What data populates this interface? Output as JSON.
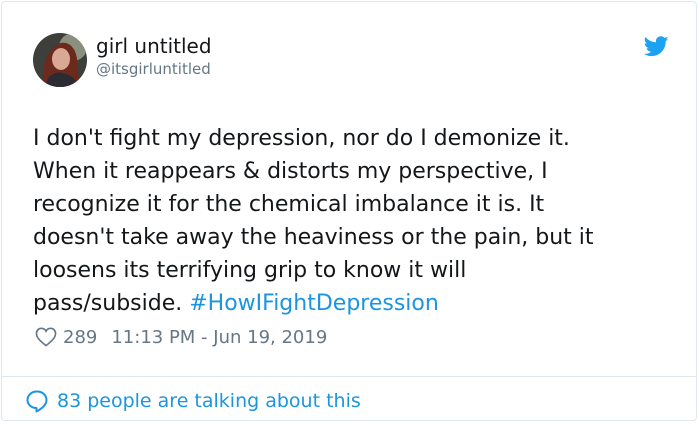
{
  "user": {
    "display_name": "girl untitled",
    "handle": "@itsgirluntitled"
  },
  "tweet": {
    "lines": [
      "I don't fight my depression, nor do I demonize it.",
      "When it reappears & distorts my perspective, I",
      "recognize it for the chemical imbalance it is. It",
      "doesn't take away the heaviness or the pain, but it",
      "loosens its terrifying grip to know it will"
    ],
    "last_line_text": "pass/subside. ",
    "hashtag": "#HowIFightDepression"
  },
  "meta": {
    "likes": "289",
    "timestamp": "11:13 PM - Jun 19, 2019"
  },
  "footer": {
    "talking": "83 people are talking about this"
  },
  "icons": {
    "bird": "twitter-bird-icon",
    "heart": "heart-outline-icon",
    "bubble": "speech-bubble-icon"
  },
  "colors": {
    "brand": "#1da1f2",
    "link": "#1b95e0",
    "text": "#14171a",
    "muted": "#657786"
  }
}
